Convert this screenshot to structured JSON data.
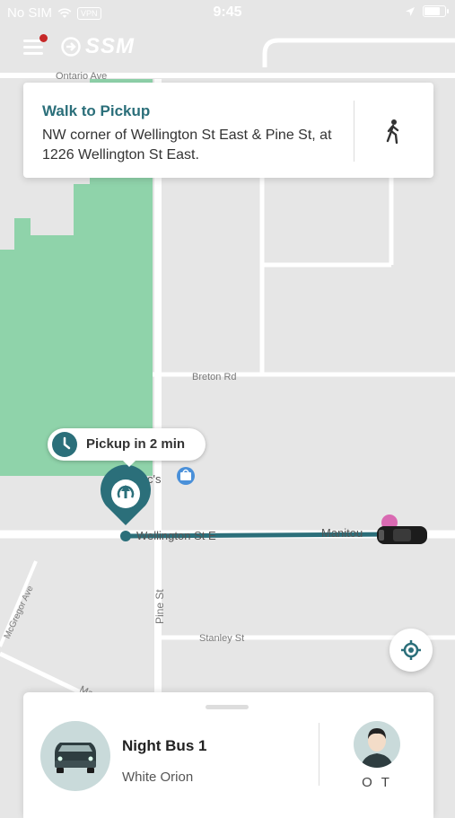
{
  "status_bar": {
    "carrier": "No SIM",
    "vpn": "VPN",
    "time": "9:45"
  },
  "header": {
    "logo_text": "SSM"
  },
  "walk_card": {
    "title": "Walk to Pickup",
    "description": "NW corner of Wellington St East & Pine St, at 1226 Wellington St East."
  },
  "map": {
    "street_labels": {
      "top": "Ontario Ave",
      "breton": "Breton Rd",
      "macs": "Mac's",
      "wellington": "Wellington St E",
      "manitou": "Manitou",
      "pine": "Pine St",
      "mcgregor": "McGregor Ave",
      "stanley": "Stanley St",
      "bottom": "Ma"
    }
  },
  "pickup_bubble": {
    "text": "Pickup in 2 min"
  },
  "vehicle_sheet": {
    "vehicle_name": "Night Bus 1",
    "vehicle_sub": "White Orion",
    "driver_initials": "O T"
  },
  "colors": {
    "accent": "#2b6f7a",
    "park": "#8fd3aa",
    "road": "#ffffff",
    "map_bg": "#e6e6e6"
  }
}
